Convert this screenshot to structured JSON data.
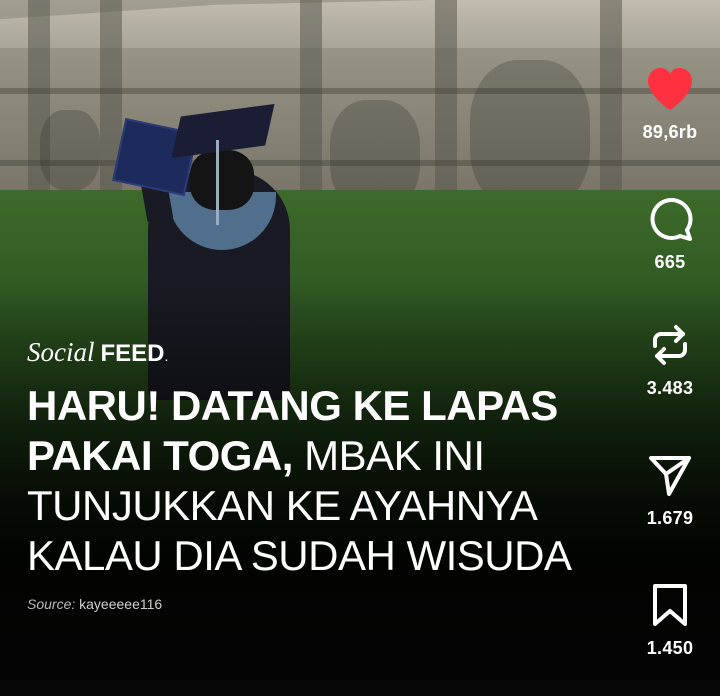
{
  "post": {
    "brand": {
      "social": "Social",
      "feed": "FEED",
      "mark": "."
    },
    "headline": {
      "line1": "HARU! DATANG KE LAPAS",
      "line2_bold": "PAKAI TOGA,",
      "line2_rest": " MBAK INI",
      "line3": "TUNJUKKAN KE AYAHNYA",
      "line4": "KALAU DIA SUDAH WISUDA"
    },
    "source": {
      "label": "Source:",
      "handle": "kayeeeee116"
    }
  },
  "actions": {
    "like": {
      "icon": "heart-icon",
      "count": "89,6rb",
      "color": "#ff3040"
    },
    "comment": {
      "icon": "comment-icon",
      "count": "665"
    },
    "repost": {
      "icon": "repost-icon",
      "count": "3.483"
    },
    "share": {
      "icon": "send-icon",
      "count": "1.679"
    },
    "save": {
      "icon": "bookmark-icon",
      "count": "1.450"
    }
  }
}
